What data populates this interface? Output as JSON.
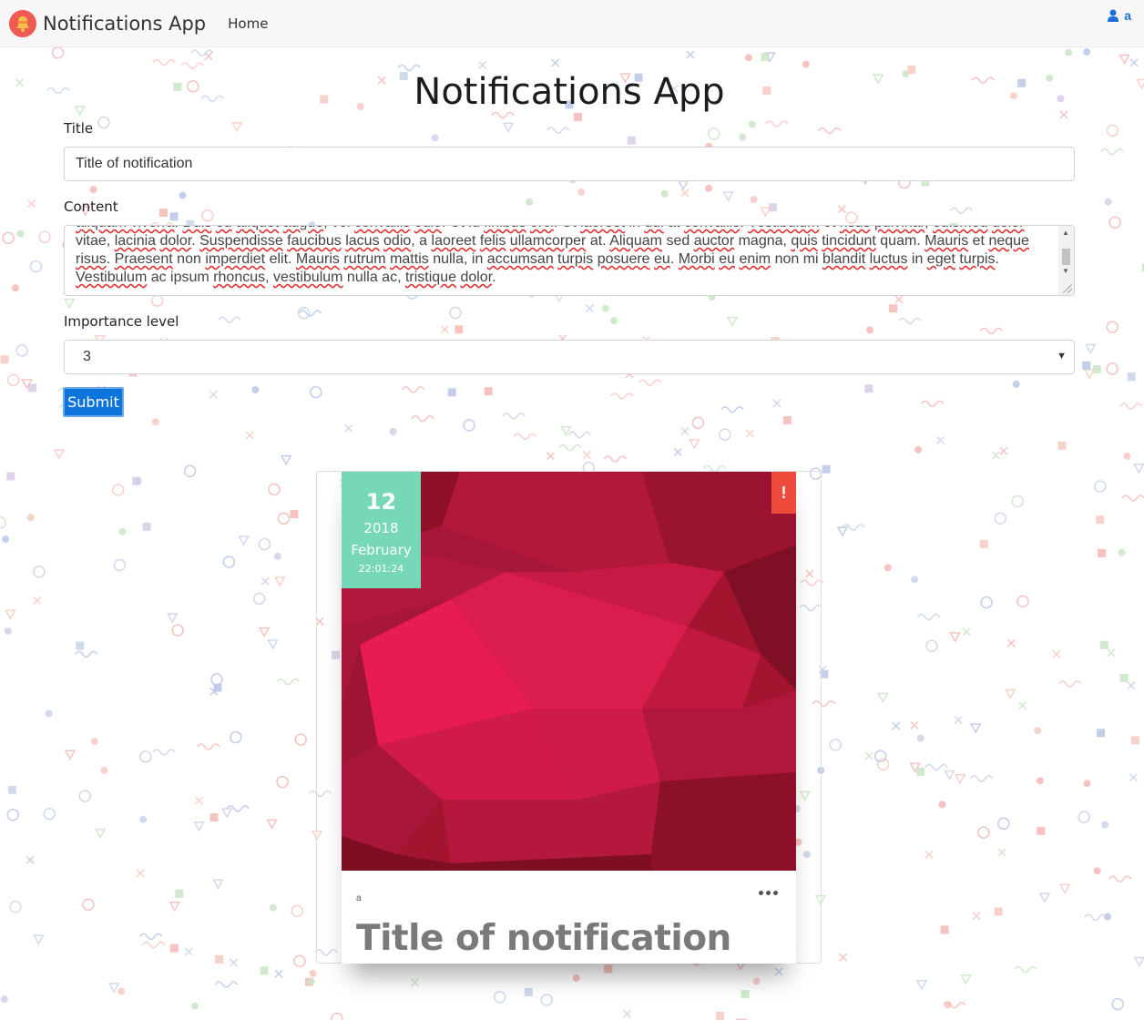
{
  "navbar": {
    "brand": "Notifications App",
    "home": "Home",
    "user": "a"
  },
  "page": {
    "heading": "Notifications App"
  },
  "form": {
    "title_label": "Title",
    "title_value": "Title of notification",
    "content_label": "Content",
    "content_lines": [
      [
        [
          "aliquam viverra",
          true
        ],
        [
          ". ",
          false
        ],
        [
          "Duis",
          true
        ],
        [
          " ",
          false
        ],
        [
          "eu",
          true
        ],
        [
          " ",
          false
        ],
        [
          "aliquet",
          true
        ],
        [
          " ",
          false
        ],
        [
          "augue",
          true
        ],
        [
          ", vel ",
          false
        ],
        [
          "convallis",
          true
        ],
        [
          " ",
          false
        ],
        [
          "odio",
          true
        ],
        [
          ". Ut id ",
          false
        ],
        [
          "finibus",
          true
        ],
        [
          " ",
          false
        ],
        [
          "orci",
          true
        ],
        [
          ". Ut ",
          false
        ],
        [
          "laoreet",
          true
        ],
        [
          " in ",
          false
        ],
        [
          "dui",
          true
        ],
        [
          " at ",
          false
        ],
        [
          "convallis",
          true
        ],
        [
          ". ",
          false
        ],
        [
          "Vestibulum",
          true
        ],
        [
          " et ",
          false
        ],
        [
          "risus",
          true
        ],
        [
          " ",
          false
        ],
        [
          "pulvinar",
          true
        ],
        [
          ", ",
          false
        ],
        [
          "euismod",
          true
        ],
        [
          " ",
          false
        ],
        [
          "dolor",
          true
        ]
      ],
      [
        [
          "vitae, ",
          false
        ],
        [
          "lacinia",
          true
        ],
        [
          " ",
          false
        ],
        [
          "dolor",
          true
        ],
        [
          ". ",
          false
        ],
        [
          "Suspendisse",
          true
        ],
        [
          " ",
          false
        ],
        [
          "faucibus",
          true
        ],
        [
          " ",
          false
        ],
        [
          "lacus",
          true
        ],
        [
          " ",
          false
        ],
        [
          "odio",
          true
        ],
        [
          ", a ",
          false
        ],
        [
          "laoreet",
          true
        ],
        [
          " ",
          false
        ],
        [
          "felis",
          true
        ],
        [
          " ",
          false
        ],
        [
          "ullamcorper",
          true
        ],
        [
          " at. ",
          false
        ],
        [
          "Aliquam",
          true
        ],
        [
          " sed ",
          false
        ],
        [
          "auctor",
          true
        ],
        [
          " magna, ",
          false
        ],
        [
          "quis",
          true
        ],
        [
          " ",
          false
        ],
        [
          "tincidunt",
          true
        ],
        [
          " quam. ",
          false
        ],
        [
          "Mauris",
          true
        ],
        [
          " et ",
          false
        ],
        [
          "neque",
          true
        ]
      ],
      [
        [
          "risus",
          true
        ],
        [
          ". ",
          false
        ],
        [
          "Praesent",
          true
        ],
        [
          " non ",
          false
        ],
        [
          "imperdiet",
          true
        ],
        [
          " elit. ",
          false
        ],
        [
          "Mauris",
          true
        ],
        [
          " ",
          false
        ],
        [
          "rutrum",
          true
        ],
        [
          " ",
          false
        ],
        [
          "mattis",
          true
        ],
        [
          " nulla, in ",
          false
        ],
        [
          "accumsan",
          true
        ],
        [
          " ",
          false
        ],
        [
          "turpis",
          true
        ],
        [
          " ",
          false
        ],
        [
          "posuere",
          true
        ],
        [
          " ",
          false
        ],
        [
          "eu",
          true
        ],
        [
          ". ",
          false
        ],
        [
          "Morbi",
          true
        ],
        [
          " ",
          false
        ],
        [
          "eu",
          true
        ],
        [
          " ",
          false
        ],
        [
          "enim",
          true
        ],
        [
          " non mi ",
          false
        ],
        [
          "blandit",
          true
        ],
        [
          " ",
          false
        ],
        [
          "luctus",
          true
        ],
        [
          " in ",
          false
        ],
        [
          "eget",
          true
        ],
        [
          " ",
          false
        ],
        [
          "turpis",
          true
        ],
        [
          ".",
          false
        ]
      ],
      [
        [
          "Vestibulum",
          true
        ],
        [
          " ac ipsum ",
          false
        ],
        [
          "rhoncus",
          true
        ],
        [
          ", ",
          false
        ],
        [
          "vestibulum",
          true
        ],
        [
          " nulla ac, ",
          false
        ],
        [
          "tristique",
          true
        ],
        [
          " ",
          false
        ],
        [
          "dolor",
          true
        ],
        [
          ".",
          false
        ]
      ]
    ],
    "importance_label": "Importance level",
    "importance_value": "3",
    "submit_label": "Submit"
  },
  "card": {
    "day": "12",
    "year": "2018",
    "month": "February",
    "time": "22:01:24",
    "importance_icon": "!",
    "author": "a",
    "title": "Title of notification",
    "colors": {
      "date_bg": "#77d8b8",
      "importance_bg": "#ef4b3c",
      "image_base": "#b3163a"
    }
  }
}
